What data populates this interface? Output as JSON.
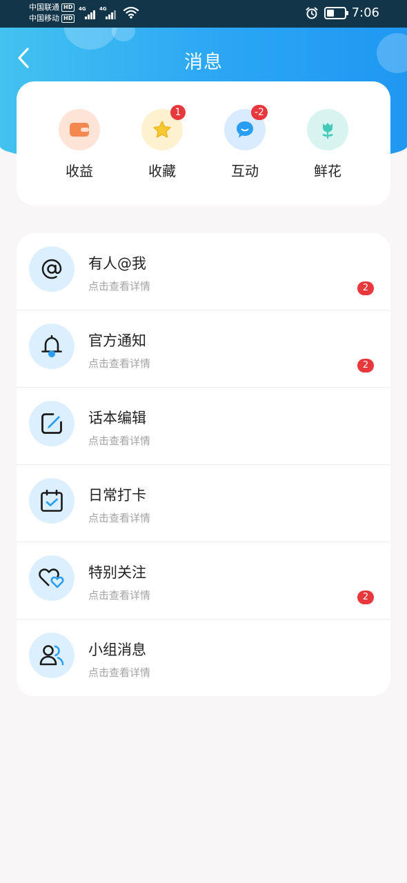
{
  "status_bar": {
    "carrier1": "中国联通",
    "carrier2": "中国移动",
    "hd": "HD",
    "network": "4G",
    "time": "7:06"
  },
  "header": {
    "title": "消息"
  },
  "top_items": [
    {
      "label": "收益",
      "icon": "wallet-icon",
      "badge": ""
    },
    {
      "label": "收藏",
      "icon": "star-icon",
      "badge": "1"
    },
    {
      "label": "互动",
      "icon": "chat-bubble-icon",
      "badge": "-2"
    },
    {
      "label": "鲜花",
      "icon": "flower-icon",
      "badge": ""
    }
  ],
  "messages": [
    {
      "title": "有人@我",
      "subtitle": "点击查看详情",
      "icon": "at-icon",
      "badge": "2"
    },
    {
      "title": "官方通知",
      "subtitle": "点击查看详情",
      "icon": "bell-icon",
      "badge": "2"
    },
    {
      "title": "话本编辑",
      "subtitle": "点击查看详情",
      "icon": "edit-icon",
      "badge": ""
    },
    {
      "title": "日常打卡",
      "subtitle": "点击查看详情",
      "icon": "calendar-check-icon",
      "badge": ""
    },
    {
      "title": "特别关注",
      "subtitle": "点击查看详情",
      "icon": "hearts-icon",
      "badge": "2"
    },
    {
      "title": "小组消息",
      "subtitle": "点击查看详情",
      "icon": "group-icon",
      "badge": ""
    }
  ],
  "colors": {
    "accent": "#2aa6f4",
    "badge": "#e8383d",
    "icon_blue": "#2a9df4"
  }
}
